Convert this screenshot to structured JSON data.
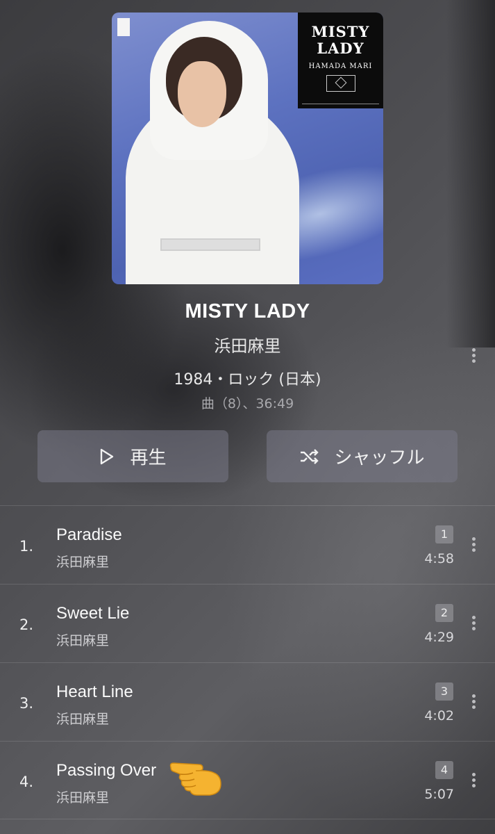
{
  "album": {
    "cover_title": "MISTY LADY",
    "cover_artist": "HAMADA MARI",
    "title": "MISTY LADY",
    "artist": "浜田麻里",
    "meta": "1984・ロック (日本)",
    "stats": "曲（8）、36:49"
  },
  "actions": {
    "play_label": "再生",
    "shuffle_label": "シャッフル"
  },
  "tracks": [
    {
      "number": "1.",
      "title": "Paradise",
      "artist": "浜田麻里",
      "badge": "1",
      "duration": "4:58"
    },
    {
      "number": "2.",
      "title": "Sweet Lie",
      "artist": "浜田麻里",
      "badge": "2",
      "duration": "4:29"
    },
    {
      "number": "3.",
      "title": "Heart Line",
      "artist": "浜田麻里",
      "badge": "3",
      "duration": "4:02"
    },
    {
      "number": "4.",
      "title": "Passing Over",
      "artist": "浜田麻里",
      "badge": "4",
      "duration": "5:07"
    }
  ],
  "icons": {
    "play": "play-icon",
    "shuffle": "shuffle-icon",
    "more": "more-vertical-icon",
    "pointer": "pointing-hand-emoji"
  },
  "colors": {
    "button_bg": "#6f6f7d",
    "pointer": "#f6b52c"
  }
}
